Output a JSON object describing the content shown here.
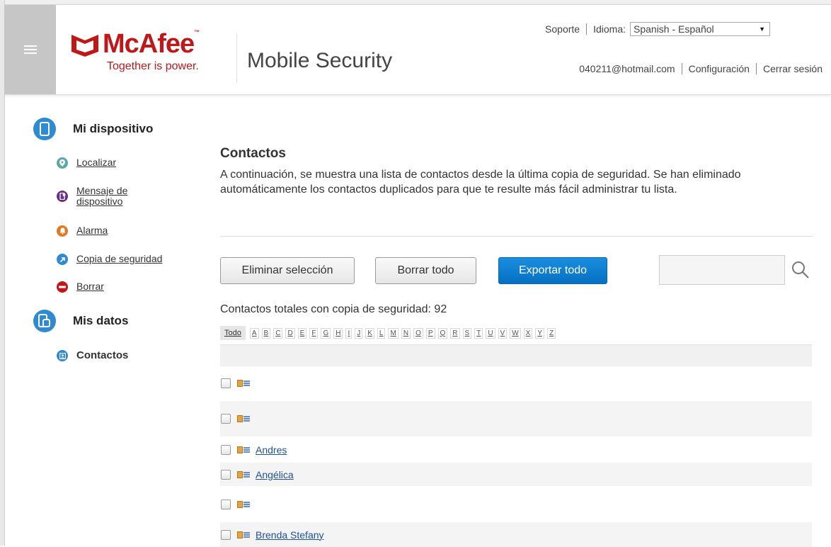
{
  "header": {
    "brand_name": "McAfee",
    "brand_tm": "™",
    "brand_tagline": "Together is power.",
    "product": "Mobile Security",
    "support": "Soporte",
    "language_label": "Idioma:",
    "language_value": "Spanish - Español",
    "user_email": "040211@hotmail.com",
    "settings": "Configuración",
    "logout": "Cerrar sesión"
  },
  "sidebar": {
    "device_section": "Mi dispositivo",
    "device_items": [
      {
        "label": "Localizar",
        "icon": "location-pin-icon",
        "color": "#5aa6a8"
      },
      {
        "label": "Mensaje de dispositivo",
        "icon": "device-message-icon",
        "color": "#6d2f86"
      },
      {
        "label": "Alarma",
        "icon": "bell-icon",
        "color": "#e07a21"
      },
      {
        "label": "Copia de seguridad",
        "icon": "backup-arrow-icon",
        "color": "#2e8ad1"
      },
      {
        "label": "Borrar",
        "icon": "erase-icon",
        "color": "#c01818"
      }
    ],
    "data_section": "Mis datos",
    "data_items": [
      {
        "label": "Contactos",
        "icon": "contacts-icon",
        "color": "#2e8ad1"
      }
    ]
  },
  "main": {
    "title": "Contactos",
    "description": "A continuación, se muestra una lista de contactos desde la última copia de seguridad. Se han eliminado automáticamente los contactos duplicados para que te resulte más fácil administrar tu lista.",
    "buttons": {
      "delete_selection": "Eliminar selección",
      "delete_all": "Borrar todo",
      "export_all": "Exportar todo"
    },
    "total_label": "Contactos totales con copia de seguridad: 92",
    "alpha_all": "Todo",
    "alpha": [
      "A",
      "B",
      "C",
      "D",
      "E",
      "F",
      "G",
      "H",
      "I",
      "J",
      "K",
      "L",
      "M",
      "N",
      "O",
      "P",
      "Q",
      "R",
      "S",
      "T",
      "U",
      "V",
      "W",
      "X",
      "Y",
      "Z"
    ],
    "contacts": [
      {
        "name": ""
      },
      {
        "name": ""
      },
      {
        "name": "Andres "
      },
      {
        "name": "Angélica"
      },
      {
        "name": ""
      },
      {
        "name": "Brenda Stefany"
      }
    ]
  },
  "colors": {
    "brand_red": "#c01818",
    "primary_blue": "#0a7ad2",
    "hamburger_gray": "#c6c6c6"
  }
}
